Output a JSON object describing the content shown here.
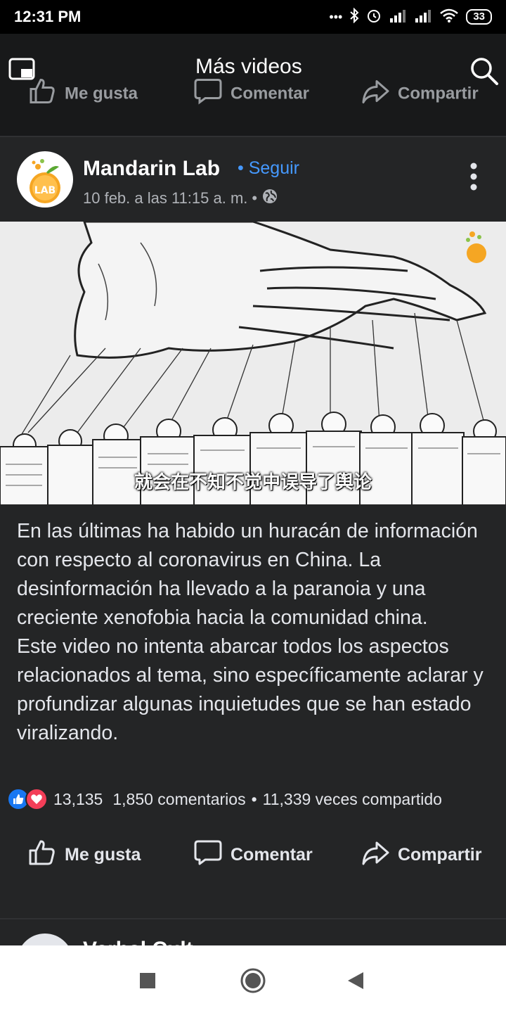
{
  "status_bar": {
    "time": "12:31 PM",
    "battery": "33"
  },
  "header": {
    "title": "Más videos",
    "ghost_like": "Me gusta",
    "ghost_comment": "Comentar",
    "ghost_share": "Compartir"
  },
  "post": {
    "author": "Mandarin Lab",
    "follow_label": "Seguir",
    "follow_dot": "•",
    "timestamp": "10 feb. a las 11:15 a. m.",
    "meta_dot": "•",
    "video_caption": "就会在不知不觉中误导了舆论",
    "logo_text": "LAB",
    "body_paragraphs": [
      "En las últimas ha habido un huracán de información con respecto al coronavirus en China. La desinformación ha llevado a la paranoia y una creciente xenofobia hacia la comunidad china.",
      "Este video no intenta abarcar todos los aspectos relacionados al tema, sino específicamente aclarar y profundizar algunas inquietudes que se han estado viralizando."
    ],
    "reaction_count": "13,135",
    "comments": "1,850 comentarios",
    "shares_dot": "•",
    "shares": "11,339 veces compartido",
    "actions": {
      "like": "Me gusta",
      "comment": "Comentar",
      "share": "Compartir"
    }
  },
  "next_post": {
    "author": "Verbal Cult..."
  },
  "colors": {
    "background": "#18191a",
    "card": "#242526",
    "accent": "#4599ff",
    "like_blue": "#1877f2",
    "love_red": "#f33e58"
  }
}
